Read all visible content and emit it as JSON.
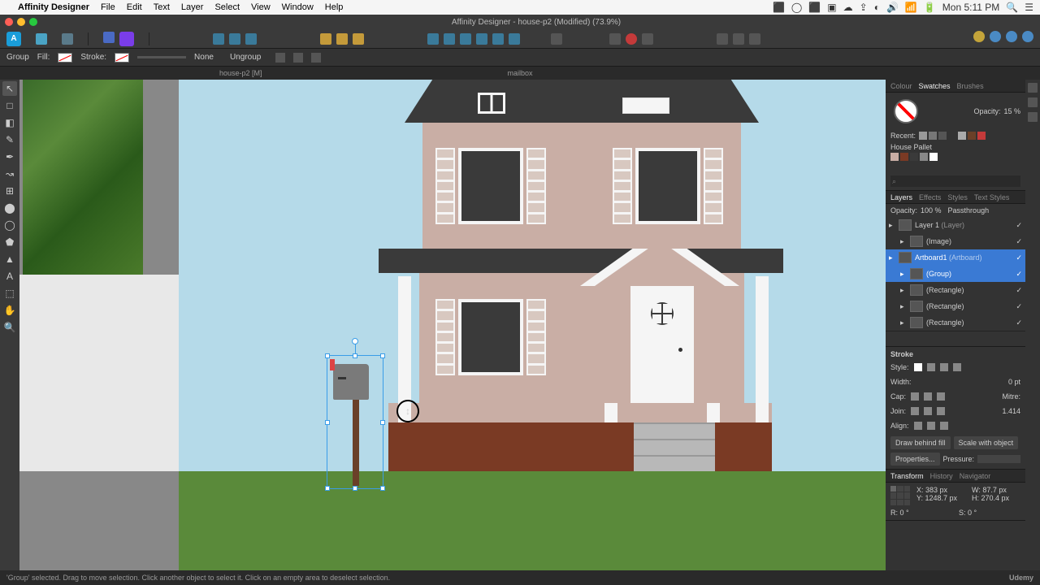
{
  "menubar": {
    "apple": "",
    "items": [
      "Affinity Designer",
      "File",
      "Edit",
      "Text",
      "Layer",
      "Select",
      "View",
      "Window",
      "Help"
    ],
    "clock": "Mon 5:11 PM"
  },
  "titlebar": {
    "title": "Affinity Designer - house-p2 (Modified) (73.9%)"
  },
  "context": {
    "group": "Group",
    "fill": "Fill:",
    "stroke": "Stroke:",
    "stroke_val": "None",
    "ungroup": "Ungroup"
  },
  "doctab": {
    "name": "house-p2 [M]",
    "selection": "mailbox"
  },
  "tools": [
    "↖",
    "□",
    "◧",
    "✎",
    "✒",
    "↝",
    "⊞",
    "⬤",
    "◯",
    "⬟",
    "▲",
    "A",
    "⬚",
    "✋",
    "🔍"
  ],
  "swatches_panel": {
    "tabs": [
      "Colour",
      "Swatches",
      "Brushes"
    ],
    "opacity_label": "Opacity:",
    "opacity_val": "15 %",
    "recent": "Recent:",
    "pallet": "House Pallet",
    "search_ph": "⌕"
  },
  "layers_panel": {
    "tabs": [
      "Layers",
      "Effects",
      "Styles",
      "Text Styles"
    ],
    "opacity_label": "Opacity:",
    "opacity_val": "100 %",
    "blend": "Passthrough",
    "items": [
      {
        "name": "Layer 1",
        "sub": "(Layer)",
        "sel": false,
        "indent": 0
      },
      {
        "name": "(Image)",
        "sub": "",
        "sel": false,
        "indent": 1
      },
      {
        "name": "Artboard1",
        "sub": "(Artboard)",
        "sel": true,
        "indent": 0
      },
      {
        "name": "(Group)",
        "sub": "",
        "sel": true,
        "indent": 1
      },
      {
        "name": "(Rectangle)",
        "sub": "",
        "sel": false,
        "indent": 1
      },
      {
        "name": "(Rectangle)",
        "sub": "",
        "sel": false,
        "indent": 1
      },
      {
        "name": "(Rectangle)",
        "sub": "",
        "sel": false,
        "indent": 1
      }
    ]
  },
  "stroke_panel": {
    "title": "Stroke",
    "style": "Style:",
    "width": "Width:",
    "width_val": "0 pt",
    "cap": "Cap:",
    "mitre": "Mitre:",
    "join": "Join:",
    "mitre_val": "1.414",
    "align": "Align:",
    "draw_behind": "Draw behind fill",
    "scale": "Scale with object",
    "properties": "Properties...",
    "pressure": "Pressure:"
  },
  "transform_panel": {
    "tabs": [
      "Transform",
      "History",
      "Navigator"
    ],
    "x": "X: 383 px",
    "w": "W: 87.7 px",
    "y": "Y: 1248.7 px",
    "h": "H: 270.4 px",
    "r": "R: 0 °",
    "s": "S: 0 °"
  },
  "status": {
    "hint": "'Group' selected. Drag to move selection. Click another object to select it. Click on an empty area to deselect selection.",
    "brand": "Udemy"
  }
}
